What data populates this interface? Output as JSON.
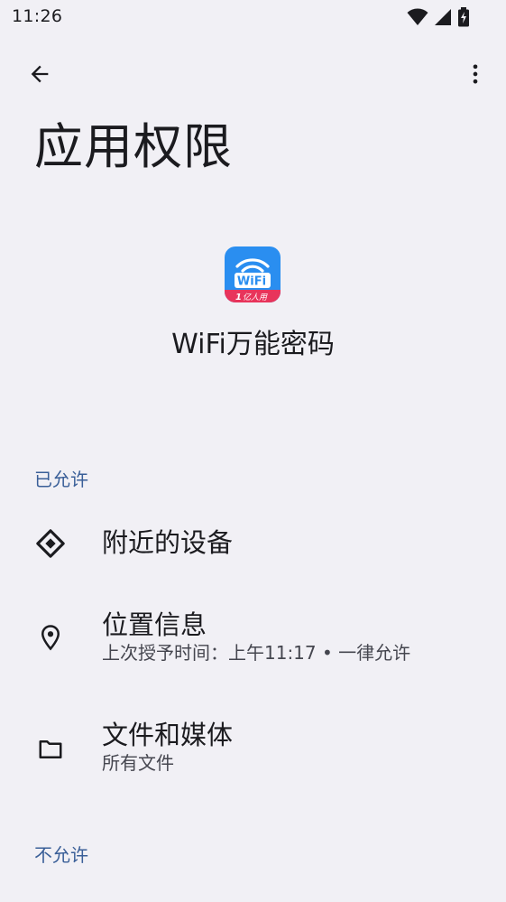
{
  "status_bar": {
    "time": "11:26",
    "icons": [
      "wifi-icon",
      "cellular-signal-icon",
      "battery-charging-icon"
    ]
  },
  "app_bar": {
    "back_icon": "arrow-back-icon",
    "more_icon": "more-vert-icon"
  },
  "page": {
    "title": "应用权限"
  },
  "app": {
    "name": "WiFi万能密码",
    "icon_text": "WiFi",
    "icon_badge": "亿人用",
    "icon_badge_num": "1",
    "colors": {
      "icon_bg": "#2196f3",
      "badge_bg": "#e8345b"
    }
  },
  "sections": {
    "allowed_label": "已允许",
    "not_allowed_label": "不允许"
  },
  "permissions": [
    {
      "title": "附近的设备",
      "subtitle": "",
      "icon": "nearby-devices-icon"
    },
    {
      "title": "位置信息",
      "subtitle": "上次授予时间：上午11:17 • 一律允许",
      "icon": "location-pin-icon"
    },
    {
      "title": "文件和媒体",
      "subtitle": "所有文件",
      "icon": "folder-icon"
    }
  ],
  "theme": {
    "background": "#f1f0f5",
    "accent": "#3a5f98",
    "text_primary": "#1b1b1f",
    "text_secondary": "#45464f"
  }
}
